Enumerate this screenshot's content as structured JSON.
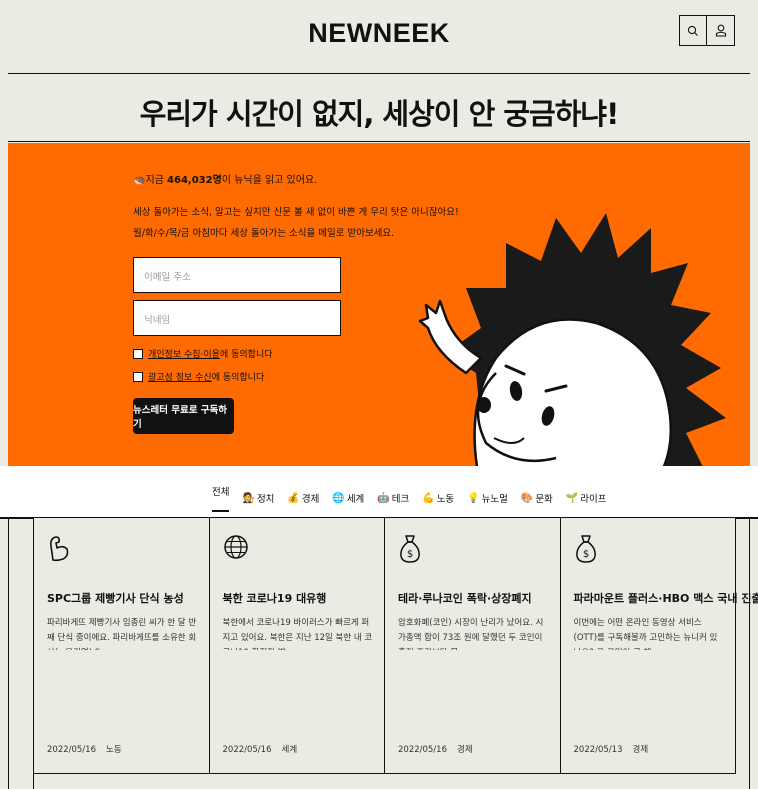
{
  "header": {
    "logo": "NEWNEEK",
    "search_icon": "search-icon",
    "user_icon": "user-icon"
  },
  "hero": {
    "title": "우리가 시간이 없지, 세상이 안 궁금하냐!",
    "stat_prefix": "지금 ",
    "stat_count": "464,032명",
    "stat_suffix": "이 뉴닉을 읽고 있어요.",
    "desc1": "세상 돌아가는 소식, 알고는 싶지만 신문 볼 새 없이 바쁜 게 우리 탓은 아니잖아요!",
    "desc2": "월/화/수/목/금 아침마다 세상 돌아가는 소식을 메일로 받아보세요.",
    "email_placeholder": "이메일 주소",
    "name_placeholder": "닉네임",
    "consent1_link": "개인정보 수집·이용",
    "consent1_rest": "에 동의합니다",
    "consent2_link": "광고성 정보 수신",
    "consent2_rest": "에 동의합니다",
    "subscribe_label": "뉴스레터 무료로 구독하기"
  },
  "categories": [
    {
      "label": "전체",
      "icon": ""
    },
    {
      "label": "정치",
      "icon": "👨‍⚖️"
    },
    {
      "label": "경제",
      "icon": "💰"
    },
    {
      "label": "세계",
      "icon": "🌐"
    },
    {
      "label": "테크",
      "icon": "🤖"
    },
    {
      "label": "노동",
      "icon": "💪"
    },
    {
      "label": "뉴노멀",
      "icon": "💡"
    },
    {
      "label": "문화",
      "icon": "🎨"
    },
    {
      "label": "라이프",
      "icon": "🌱"
    }
  ],
  "cards": [
    {
      "icon": "muscle-icon",
      "title": "SPC그룹 제빵기사 단식 농성",
      "summary": "파리바게뜨 제빵기사 임종린 씨가 한 달 반째 단식 중이에요. 파리바게뜨를 소유한 회사(=모기업) S…",
      "date": "2022/05/16",
      "category": "노동"
    },
    {
      "icon": "globe-icon",
      "title": "북한 코로나19 대유행",
      "summary": "북한에서 코로나19 바이러스가 빠르게 퍼지고 있어요. 북한은 지난 12일 북한 내 코로나19 확진자 발…",
      "date": "2022/05/16",
      "category": "세계"
    },
    {
      "icon": "money-bag-icon",
      "title": "테라·루나코인 폭락·상장폐지",
      "summary": "암호화폐(코인) 시장이 난리가 났어요. 시가총액 합이 73조 원에 달했던 두 코인이 휴지 조각보다 못…",
      "date": "2022/05/16",
      "category": "경제"
    },
    {
      "icon": "money-bag-icon",
      "title": "파라마운트 플러스·HBO 맥스 국내 진출",
      "summary": "이번에는 어떤 온라인 동영상 서비스(OTT)를 구독해볼까 고민하는 뉴니커 있나요? 그 고민이 곧 해…",
      "date": "2022/05/13",
      "category": "경제"
    }
  ]
}
